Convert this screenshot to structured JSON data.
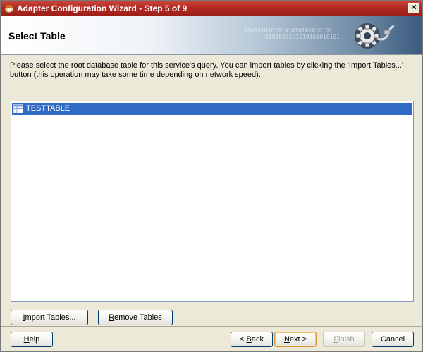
{
  "window": {
    "title": "Adapter Configuration Wizard - Step 5 of 9",
    "close_label": "✕"
  },
  "banner": {
    "title": "Select Table",
    "binary_text": [
      "01010101010101010101010101",
      "0101010101010101010101"
    ]
  },
  "description": "Please select the root database table for this service's query.  You can import tables by clicking the 'Import Tables...' button (this operation may take some time depending on network speed).",
  "table_list": {
    "items": [
      {
        "label": "TESTTABLE",
        "selected": true,
        "icon": "table-icon"
      }
    ]
  },
  "buttons": {
    "import_prefix": "I",
    "import_rest": "mport Tables...",
    "remove_prefix": "R",
    "remove_rest": "emove Tables",
    "help_prefix": "H",
    "help_rest": "elp",
    "back_pre": "< ",
    "back_u": "B",
    "back_rest": "ack",
    "next_u": "N",
    "next_rest": "ext >",
    "finish_u": "F",
    "finish_rest": "inish",
    "cancel": "Cancel"
  },
  "colors": {
    "titlebar": "#b32b22",
    "selection": "#316ac5",
    "default_button_border": "#d79a3b"
  }
}
